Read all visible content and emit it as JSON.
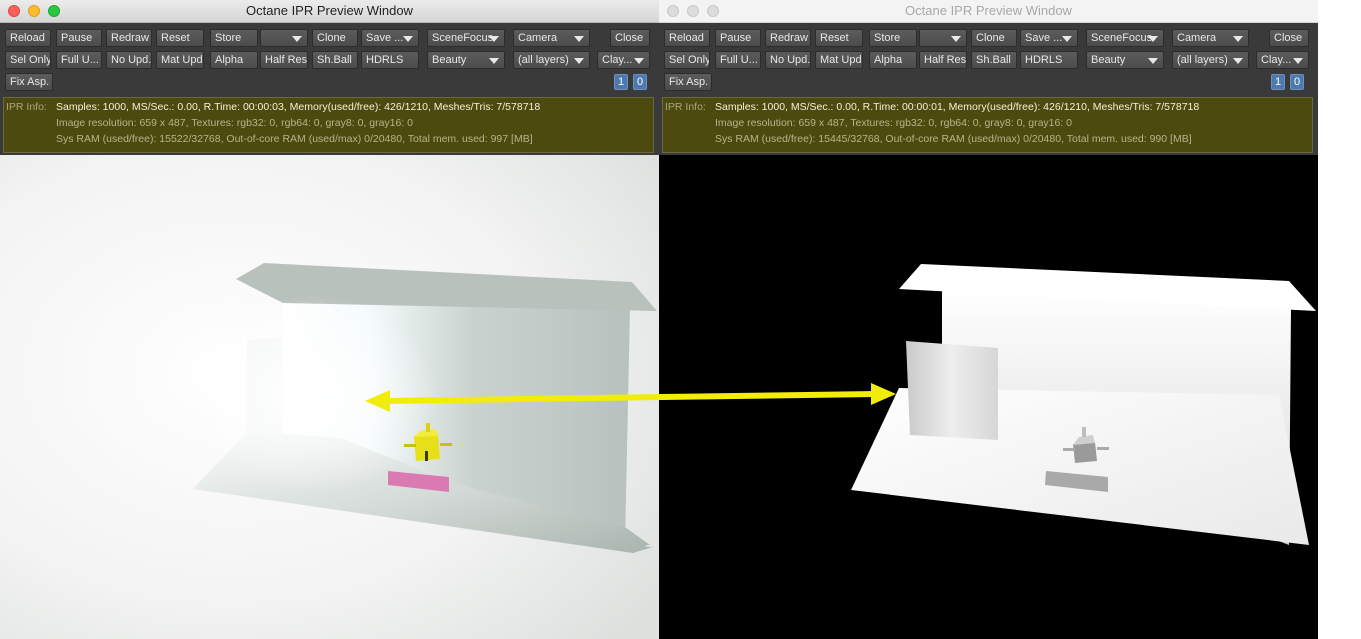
{
  "windows": [
    {
      "title": "Octane IPR Preview Window",
      "row1": {
        "reload": "Reload",
        "pause": "Pause",
        "redraw": "Redraw",
        "reset": "Reset",
        "store": "Store",
        "store_select": "",
        "clone": "Clone",
        "save": "Save ...",
        "scenefocus": "SceneFocus",
        "camera": "Camera",
        "close": "Close"
      },
      "row2": {
        "sel_only": "Sel Only",
        "full_upd": "Full U...",
        "no_upd": "No Upd.",
        "mat_upd": "Mat Upd",
        "alpha": "Alpha",
        "half_res": "Half Res",
        "sh_ball": "Sh.Ball",
        "hdrls": "HDRLS",
        "beauty": "Beauty",
        "layers": "(all layers)",
        "clay": "Clay..."
      },
      "row3": {
        "fix_asp": "Fix Asp.",
        "num1": "1",
        "num0": "0"
      },
      "info": {
        "label": "IPR Info:",
        "line1": "Samples: 1000, MS/Sec.: 0.00, R.Time: 00:00:03, Memory(used/free): 426/1210, Meshes/Tris: 7/578718",
        "line2": "Image resolution: 659 x 487, Textures:  rgb32: 0, rgb64: 0, gray8: 0, gray16: 0",
        "line3": "Sys RAM (used/free): 15522/32768, Out-of-core RAM (used/max) 0/20480, Total mem. used: 997  [MB]"
      }
    },
    {
      "title": "Octane IPR Preview Window",
      "row1": {
        "reload": "Reload",
        "pause": "Pause",
        "redraw": "Redraw",
        "reset": "Reset",
        "store": "Store",
        "store_select": "",
        "clone": "Clone",
        "save": "Save ...",
        "scenefocus": "SceneFocus",
        "camera": "Camera",
        "close": "Close"
      },
      "row2": {
        "sel_only": "Sel Only",
        "full_upd": "Full U...",
        "no_upd": "No Upd.",
        "mat_upd": "Mat Upd",
        "alpha": "Alpha",
        "half_res": "Half Res",
        "sh_ball": "Sh.Ball",
        "hdrls": "HDRLS",
        "beauty": "Beauty",
        "layers": "(all layers)",
        "clay": "Clay..."
      },
      "row3": {
        "fix_asp": "Fix Asp.",
        "num1": "1",
        "num0": "0"
      },
      "info": {
        "label": "IPR Info:",
        "line1": "Samples: 1000, MS/Sec.: 0.00, R.Time: 00:00:01, Memory(used/free): 426/1210, Meshes/Tris: 7/578718",
        "line2": "Image resolution: 659 x 487, Textures:  rgb32: 0, rgb64: 0, gray8: 0, gray16: 0",
        "line3": "Sys RAM (used/free): 15445/32768, Out-of-core RAM (used/max) 0/20480, Total mem. used: 990  [MB]"
      }
    }
  ],
  "colors": {
    "arrow": "#f2ec0a",
    "info_bg": "#4d4a10",
    "button_active_blue": "#4f78ad"
  }
}
